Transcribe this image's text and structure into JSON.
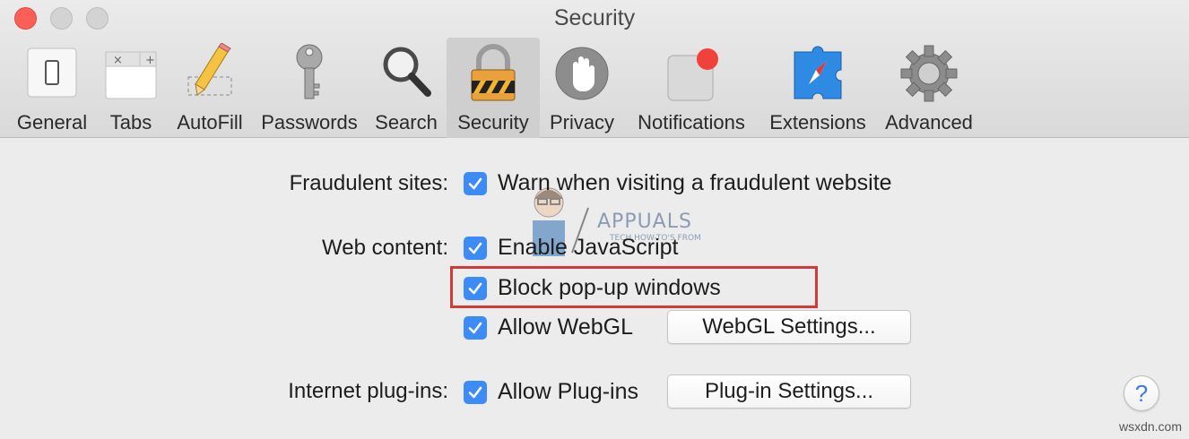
{
  "window": {
    "title": "Security"
  },
  "toolbar": {
    "items": [
      {
        "label": "General",
        "icon": "general-switch-icon"
      },
      {
        "label": "Tabs",
        "icon": "tabs-icon"
      },
      {
        "label": "AutoFill",
        "icon": "autofill-pencil-icon"
      },
      {
        "label": "Passwords",
        "icon": "key-icon"
      },
      {
        "label": "Search",
        "icon": "magnifier-icon"
      },
      {
        "label": "Security",
        "icon": "padlock-icon",
        "selected": true
      },
      {
        "label": "Privacy",
        "icon": "hand-icon"
      },
      {
        "label": "Notifications",
        "icon": "notification-badge-icon"
      },
      {
        "label": "Extensions",
        "icon": "puzzle-compass-icon"
      },
      {
        "label": "Advanced",
        "icon": "gear-icon"
      }
    ]
  },
  "fraudulent": {
    "label": "Fraudulent sites:",
    "warn": {
      "label": "Warn when visiting a fraudulent website",
      "checked": true
    }
  },
  "web_content": {
    "label": "Web content:",
    "javascript": {
      "label": "Enable JavaScript",
      "checked": true
    },
    "popups": {
      "label": "Block pop-up windows",
      "checked": true
    },
    "webgl": {
      "label": "Allow WebGL",
      "checked": true,
      "button": "WebGL Settings..."
    }
  },
  "plugins": {
    "label": "Internet plug-ins:",
    "allow": {
      "label": "Allow Plug-ins",
      "checked": true,
      "button": "Plug-in Settings..."
    }
  },
  "help": {
    "symbol": "?"
  },
  "watermark": {
    "brand": "APPUALS",
    "tagline": "TECH HOW-TO'S FROM"
  },
  "credit": "wsxdn.com",
  "colors": {
    "checkbox": "#3d8bf7",
    "highlight": "#d23a3a",
    "close_button": "#fc5f57"
  }
}
